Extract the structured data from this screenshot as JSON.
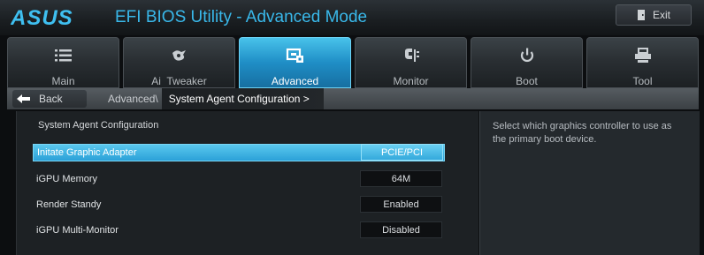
{
  "app": {
    "logo_text": "ASUS",
    "title": "EFI BIOS Utility - Advanced Mode",
    "exit_label": "Exit"
  },
  "colors": {
    "accent": "#39b8ea",
    "active_tab": "#1f8ec6",
    "selected_row": "#2ba1d8"
  },
  "tabs": [
    {
      "label": "Main",
      "icon": "list-icon",
      "active": false
    },
    {
      "label": "Ai  Tweaker",
      "icon": "tweaker-icon",
      "active": false
    },
    {
      "label": "Advanced",
      "icon": "chip-icon",
      "active": true
    },
    {
      "label": "Monitor",
      "icon": "monitor-icon",
      "active": false
    },
    {
      "label": "Boot",
      "icon": "power-icon",
      "active": false
    },
    {
      "label": "Tool",
      "icon": "printer-icon",
      "active": false
    }
  ],
  "breadcrumb": {
    "back_label": "Back",
    "path": "Advanced\\",
    "current": "System Agent Configuration  >"
  },
  "main": {
    "section_title": "System Agent Configuration",
    "settings": [
      {
        "label": "Initate Graphic Adapter",
        "value": "PCIE/PCI",
        "selected": true
      },
      {
        "label": "iGPU Memory",
        "value": "64M",
        "selected": false
      },
      {
        "label": "Render Standy",
        "value": "Enabled",
        "selected": false
      },
      {
        "label": "iGPU Multi-Monitor",
        "value": "Disabled",
        "selected": false
      }
    ]
  },
  "help": {
    "text": "Select which graphics controller to use as the primary boot device."
  }
}
